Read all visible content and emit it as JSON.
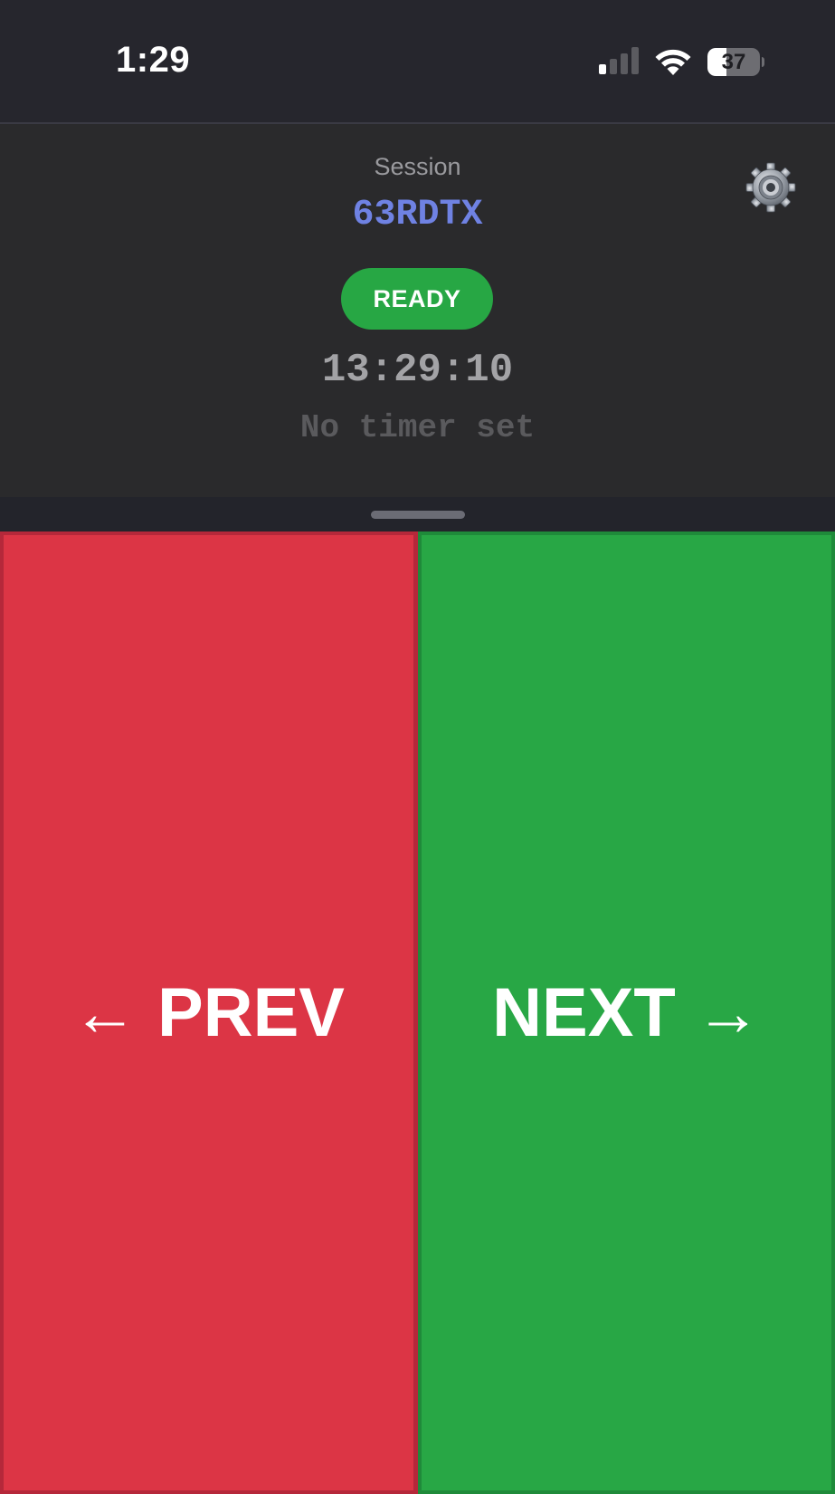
{
  "status_bar": {
    "time": "1:29",
    "battery_percent": 37,
    "battery_text": "37",
    "signal_bars": 1
  },
  "header": {
    "session_label": "Session",
    "session_code": "63RDTX",
    "status": "READY",
    "clock": "13:29:10",
    "timer_text": "No timer set"
  },
  "controls": {
    "prev_label": "PREV",
    "prev_arrow": "←",
    "next_label": "NEXT",
    "next_arrow": "→"
  },
  "colors": {
    "prev": "#dc3545",
    "next": "#28a745",
    "ready": "#27a744",
    "session_code": "#6f82e3"
  },
  "icons": {
    "settings": "gear-icon",
    "signal": "cellular-signal-icon",
    "wifi": "wifi-icon",
    "battery": "battery-icon"
  }
}
